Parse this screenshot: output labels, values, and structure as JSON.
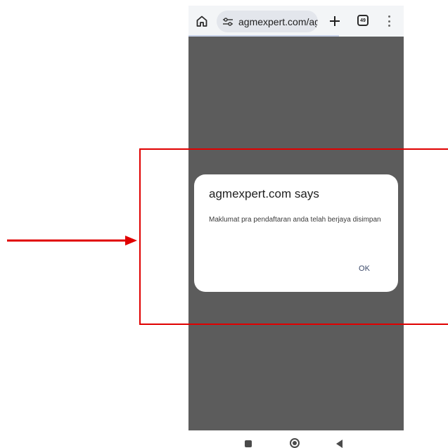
{
  "browser": {
    "url": "agmexpert.com/agi",
    "tab_count": "49",
    "icons": {
      "home": "home-icon",
      "site_settings": "tune-icon",
      "new_tab": "plus-icon",
      "tabs": "tab-switcher-icon",
      "menu": "more-vert-icon"
    }
  },
  "dialog": {
    "title": "agmexpert.com says",
    "message": "Maklumat pra pendaftaran anda telah berjaya disimpan",
    "ok_label": "OK"
  },
  "system_nav": {
    "icons": [
      "recents-icon",
      "home-circle-icon",
      "back-icon"
    ]
  },
  "annotation": {
    "color": "#e00000"
  }
}
